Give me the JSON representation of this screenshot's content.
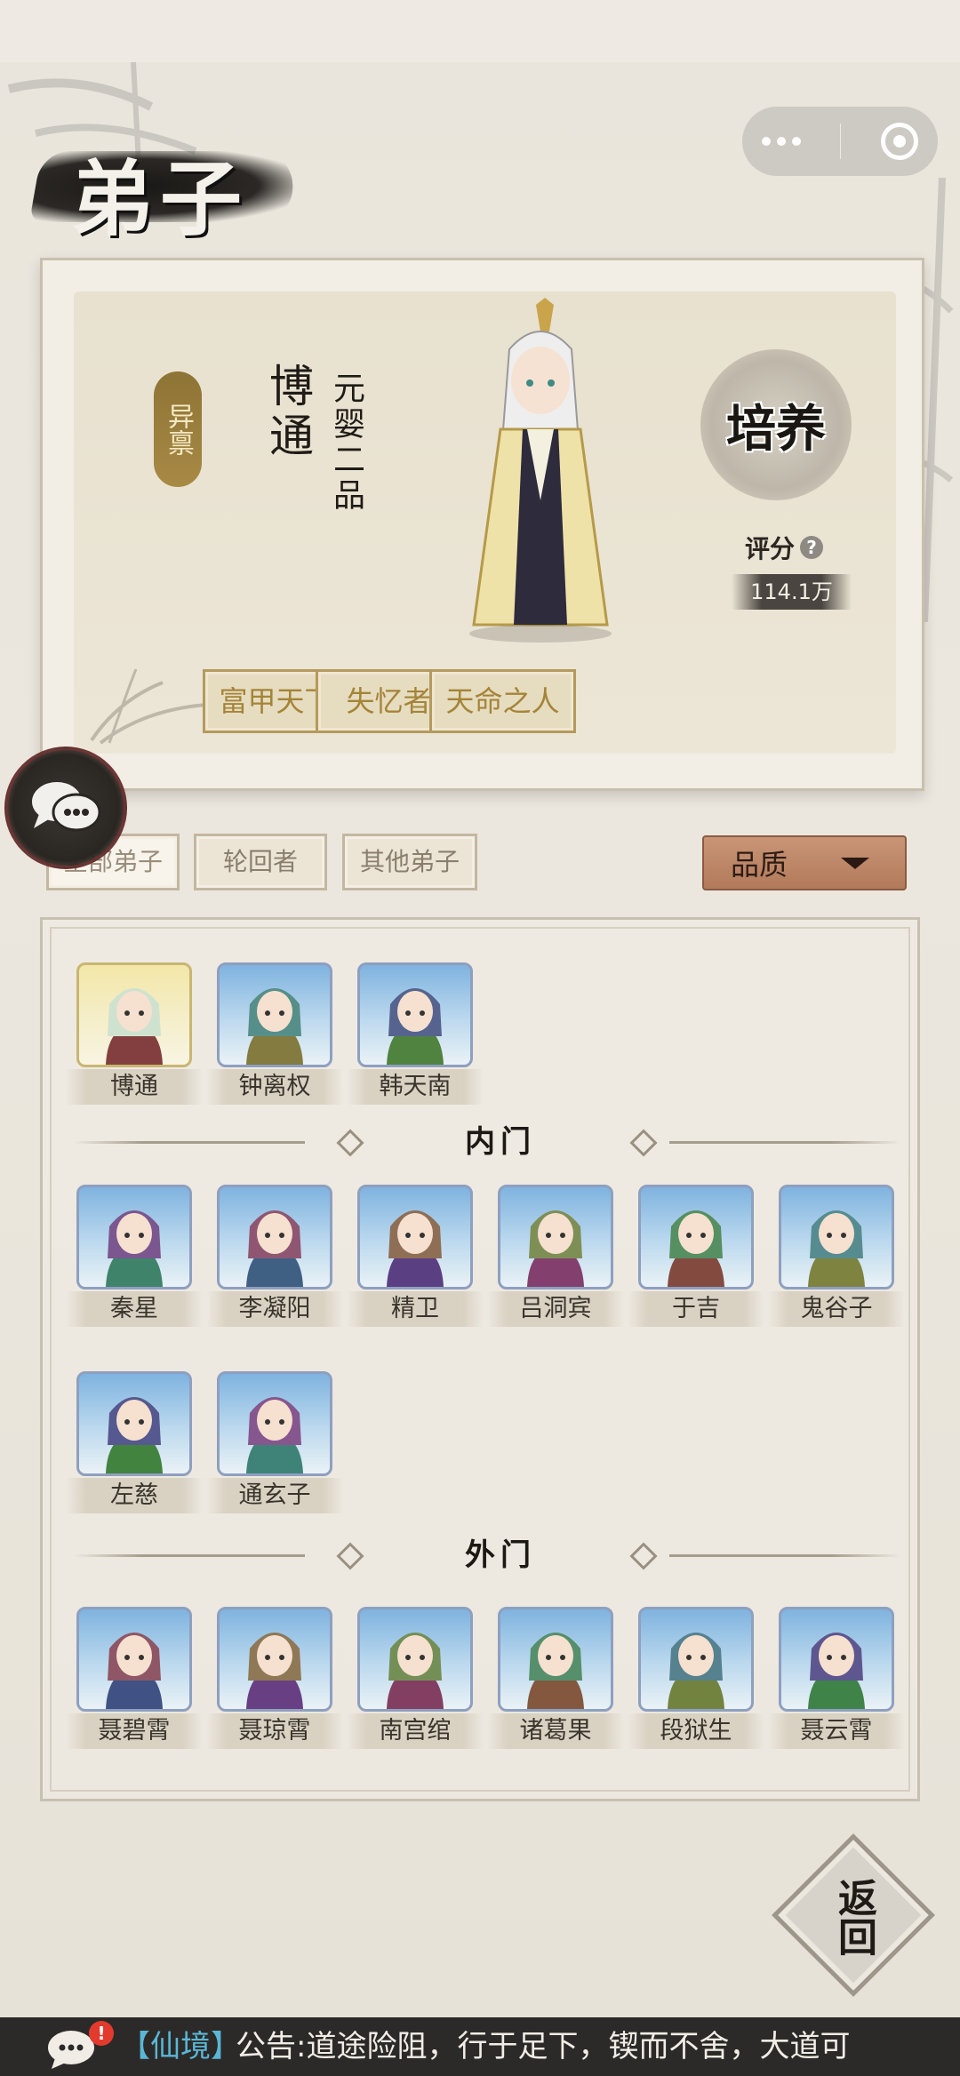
{
  "page": {
    "title": "弟子"
  },
  "featured": {
    "quality_tag": "异禀",
    "name": "博通",
    "rank": "元婴二品",
    "cultivate_label": "培养",
    "score_label": "评分",
    "score_value": "114.1万",
    "traits": [
      "富甲天下",
      "失忆者",
      "天命之人"
    ]
  },
  "filters": {
    "tabs": [
      {
        "label": "全部弟子",
        "active": true
      },
      {
        "label": "轮回者",
        "active": false
      },
      {
        "label": "其他弟子",
        "active": false
      }
    ],
    "sort_label": "品质"
  },
  "roster": {
    "top_row": [
      {
        "name": "博通",
        "frame": "gold"
      },
      {
        "name": "钟离权",
        "frame": "blue"
      },
      {
        "name": "韩天南",
        "frame": "blue"
      }
    ],
    "inner": {
      "title": "内门",
      "members": [
        "秦星",
        "李凝阳",
        "精卫",
        "吕洞宾",
        "于吉",
        "鬼谷子",
        "左慈",
        "通玄子"
      ]
    },
    "outer": {
      "title": "外门",
      "members": [
        "聂碧霄",
        "聂琼霄",
        "南宫绾",
        "诸葛果",
        "段狱生",
        "聂云霄"
      ]
    }
  },
  "return_label": "返回",
  "announcement": {
    "badge": "!",
    "tag": "【仙境】",
    "text": "公告:道途险阻，行于足下，锲而不舍，大道可"
  },
  "colors": {
    "background": "#e9e5dc",
    "gold_text": "#a48438",
    "quality_button": "#b27a5b",
    "portrait_blue": "#7fb3df",
    "announce_bar": "#2c2a28",
    "announce_tag": "#5ab6d6"
  }
}
